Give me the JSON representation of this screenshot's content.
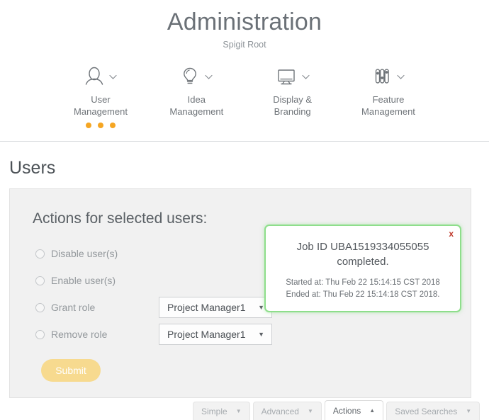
{
  "header": {
    "title": "Administration",
    "subtitle": "Spigit Root"
  },
  "nav": {
    "items": [
      {
        "label_line1": "User",
        "label_line2": "Management",
        "icon": "person-icon",
        "chevron": "chevron-down-icon",
        "dots": 3
      },
      {
        "label_line1": "Idea",
        "label_line2": "Management",
        "icon": "lightbulb-icon",
        "chevron": "chevron-down-icon",
        "dots": 0
      },
      {
        "label_line1": "Display &",
        "label_line2": "Branding",
        "icon": "monitor-icon",
        "chevron": "chevron-down-icon",
        "dots": 0
      },
      {
        "label_line1": "Feature",
        "label_line2": "Management",
        "icon": "sliders-icon",
        "chevron": "chevron-down-icon",
        "dots": 0
      }
    ]
  },
  "page": {
    "title": "Users"
  },
  "panel": {
    "heading": "Actions for selected users:",
    "actions": [
      {
        "label": "Disable user(s)",
        "selected": false,
        "has_select": false
      },
      {
        "label": "Enable user(s)",
        "selected": false,
        "has_select": false
      },
      {
        "label": "Grant role",
        "selected": false,
        "has_select": true,
        "select_value": "Project Manager1",
        "select_caret": "▼"
      },
      {
        "label": "Remove role",
        "selected": false,
        "has_select": true,
        "select_value": "Project Manager1",
        "select_caret": "▼"
      }
    ],
    "submit_label": "Submit"
  },
  "notification": {
    "close_label": "x",
    "title": "Job ID UBA1519334055055 completed.",
    "started_at": "Started at: Thu Feb 22 15:14:15 CST 2018",
    "ended_at": "Ended at: Thu Feb 22 15:14:18 CST 2018.",
    "border_color": "#8ede8b"
  },
  "tabs": [
    {
      "label": "Simple",
      "caret": "▼",
      "active": false
    },
    {
      "label": "Advanced",
      "caret": "▼",
      "active": false
    },
    {
      "label": "Actions",
      "caret": "▲",
      "active": true
    },
    {
      "label": "Saved Searches",
      "caret": "▼",
      "active": false
    }
  ],
  "colors": {
    "accent_orange": "#f5a623",
    "submit_bg": "#f7da8f",
    "notification_green": "#8ede8b",
    "close_red": "#c0392b"
  }
}
